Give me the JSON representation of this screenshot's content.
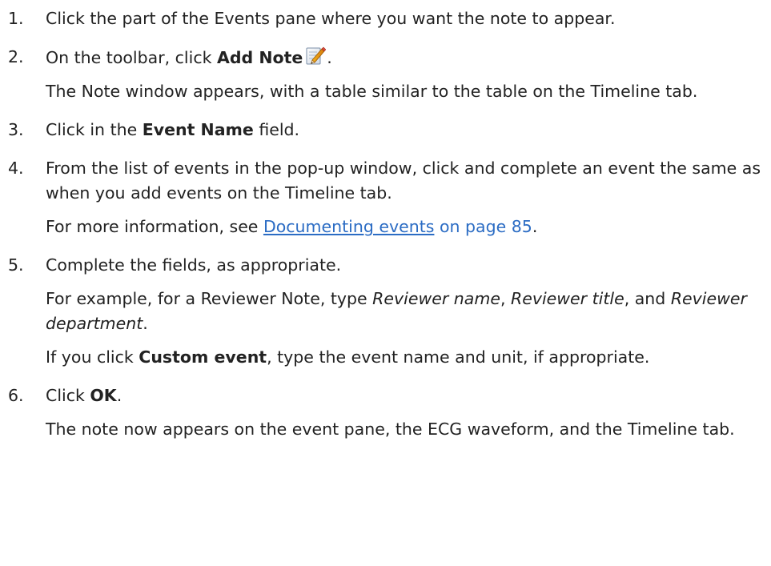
{
  "steps": [
    {
      "number": "1.",
      "text": "Click the part of the Events pane where you want the note to appear."
    },
    {
      "number": "2.",
      "pre": "On the toolbar, click ",
      "bold": "Add Note",
      "post": ".",
      "icon": "add-note-pencil-icon",
      "detail": "The Note window appears, with a table similar to the table on the Timeline tab."
    },
    {
      "number": "3.",
      "pre": "Click in the ",
      "bold": "Event Name",
      "post": " field."
    },
    {
      "number": "4.",
      "text": "From the list of events in the pop-up window, click and complete an event the same as when you add events on the Timeline tab.",
      "detail_pre": "For more information, see ",
      "link": "Documenting events",
      "ref": " on page 85",
      "detail_post": "."
    },
    {
      "number": "5.",
      "text": "Complete the fields, as appropriate.",
      "ex_pre": "For example, for a Reviewer Note, type ",
      "ex_i1": "Reviewer name",
      "ex_mid1": ", ",
      "ex_i2": "Reviewer title",
      "ex_mid2": ", and ",
      "ex_i3": "Reviewer department",
      "ex_post": ".",
      "custom_pre": "If you click ",
      "custom_bold": "Custom event",
      "custom_post": ", type the event name and unit, if appropriate."
    },
    {
      "number": "6.",
      "pre": "Click ",
      "bold": "OK",
      "post": ".",
      "detail": "The note now appears on the event pane, the ECG waveform, and the Timeline tab."
    }
  ],
  "colors": {
    "text": "#222222",
    "link": "#2b6cc4"
  }
}
